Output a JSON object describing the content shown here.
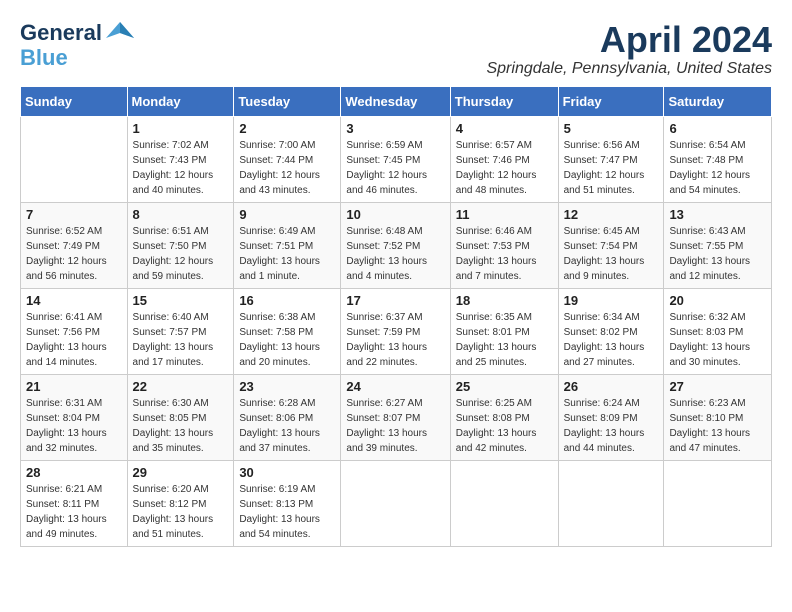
{
  "logo": {
    "line1": "General",
    "line2": "Blue",
    "bird_symbol": "▲"
  },
  "title": "April 2024",
  "location": "Springdale, Pennsylvania, United States",
  "days_of_week": [
    "Sunday",
    "Monday",
    "Tuesday",
    "Wednesday",
    "Thursday",
    "Friday",
    "Saturday"
  ],
  "weeks": [
    [
      {
        "day": "",
        "sunrise": "",
        "sunset": "",
        "daylight": ""
      },
      {
        "day": "1",
        "sunrise": "Sunrise: 7:02 AM",
        "sunset": "Sunset: 7:43 PM",
        "daylight": "Daylight: 12 hours and 40 minutes."
      },
      {
        "day": "2",
        "sunrise": "Sunrise: 7:00 AM",
        "sunset": "Sunset: 7:44 PM",
        "daylight": "Daylight: 12 hours and 43 minutes."
      },
      {
        "day": "3",
        "sunrise": "Sunrise: 6:59 AM",
        "sunset": "Sunset: 7:45 PM",
        "daylight": "Daylight: 12 hours and 46 minutes."
      },
      {
        "day": "4",
        "sunrise": "Sunrise: 6:57 AM",
        "sunset": "Sunset: 7:46 PM",
        "daylight": "Daylight: 12 hours and 48 minutes."
      },
      {
        "day": "5",
        "sunrise": "Sunrise: 6:56 AM",
        "sunset": "Sunset: 7:47 PM",
        "daylight": "Daylight: 12 hours and 51 minutes."
      },
      {
        "day": "6",
        "sunrise": "Sunrise: 6:54 AM",
        "sunset": "Sunset: 7:48 PM",
        "daylight": "Daylight: 12 hours and 54 minutes."
      }
    ],
    [
      {
        "day": "7",
        "sunrise": "Sunrise: 6:52 AM",
        "sunset": "Sunset: 7:49 PM",
        "daylight": "Daylight: 12 hours and 56 minutes."
      },
      {
        "day": "8",
        "sunrise": "Sunrise: 6:51 AM",
        "sunset": "Sunset: 7:50 PM",
        "daylight": "Daylight: 12 hours and 59 minutes."
      },
      {
        "day": "9",
        "sunrise": "Sunrise: 6:49 AM",
        "sunset": "Sunset: 7:51 PM",
        "daylight": "Daylight: 13 hours and 1 minute."
      },
      {
        "day": "10",
        "sunrise": "Sunrise: 6:48 AM",
        "sunset": "Sunset: 7:52 PM",
        "daylight": "Daylight: 13 hours and 4 minutes."
      },
      {
        "day": "11",
        "sunrise": "Sunrise: 6:46 AM",
        "sunset": "Sunset: 7:53 PM",
        "daylight": "Daylight: 13 hours and 7 minutes."
      },
      {
        "day": "12",
        "sunrise": "Sunrise: 6:45 AM",
        "sunset": "Sunset: 7:54 PM",
        "daylight": "Daylight: 13 hours and 9 minutes."
      },
      {
        "day": "13",
        "sunrise": "Sunrise: 6:43 AM",
        "sunset": "Sunset: 7:55 PM",
        "daylight": "Daylight: 13 hours and 12 minutes."
      }
    ],
    [
      {
        "day": "14",
        "sunrise": "Sunrise: 6:41 AM",
        "sunset": "Sunset: 7:56 PM",
        "daylight": "Daylight: 13 hours and 14 minutes."
      },
      {
        "day": "15",
        "sunrise": "Sunrise: 6:40 AM",
        "sunset": "Sunset: 7:57 PM",
        "daylight": "Daylight: 13 hours and 17 minutes."
      },
      {
        "day": "16",
        "sunrise": "Sunrise: 6:38 AM",
        "sunset": "Sunset: 7:58 PM",
        "daylight": "Daylight: 13 hours and 20 minutes."
      },
      {
        "day": "17",
        "sunrise": "Sunrise: 6:37 AM",
        "sunset": "Sunset: 7:59 PM",
        "daylight": "Daylight: 13 hours and 22 minutes."
      },
      {
        "day": "18",
        "sunrise": "Sunrise: 6:35 AM",
        "sunset": "Sunset: 8:01 PM",
        "daylight": "Daylight: 13 hours and 25 minutes."
      },
      {
        "day": "19",
        "sunrise": "Sunrise: 6:34 AM",
        "sunset": "Sunset: 8:02 PM",
        "daylight": "Daylight: 13 hours and 27 minutes."
      },
      {
        "day": "20",
        "sunrise": "Sunrise: 6:32 AM",
        "sunset": "Sunset: 8:03 PM",
        "daylight": "Daylight: 13 hours and 30 minutes."
      }
    ],
    [
      {
        "day": "21",
        "sunrise": "Sunrise: 6:31 AM",
        "sunset": "Sunset: 8:04 PM",
        "daylight": "Daylight: 13 hours and 32 minutes."
      },
      {
        "day": "22",
        "sunrise": "Sunrise: 6:30 AM",
        "sunset": "Sunset: 8:05 PM",
        "daylight": "Daylight: 13 hours and 35 minutes."
      },
      {
        "day": "23",
        "sunrise": "Sunrise: 6:28 AM",
        "sunset": "Sunset: 8:06 PM",
        "daylight": "Daylight: 13 hours and 37 minutes."
      },
      {
        "day": "24",
        "sunrise": "Sunrise: 6:27 AM",
        "sunset": "Sunset: 8:07 PM",
        "daylight": "Daylight: 13 hours and 39 minutes."
      },
      {
        "day": "25",
        "sunrise": "Sunrise: 6:25 AM",
        "sunset": "Sunset: 8:08 PM",
        "daylight": "Daylight: 13 hours and 42 minutes."
      },
      {
        "day": "26",
        "sunrise": "Sunrise: 6:24 AM",
        "sunset": "Sunset: 8:09 PM",
        "daylight": "Daylight: 13 hours and 44 minutes."
      },
      {
        "day": "27",
        "sunrise": "Sunrise: 6:23 AM",
        "sunset": "Sunset: 8:10 PM",
        "daylight": "Daylight: 13 hours and 47 minutes."
      }
    ],
    [
      {
        "day": "28",
        "sunrise": "Sunrise: 6:21 AM",
        "sunset": "Sunset: 8:11 PM",
        "daylight": "Daylight: 13 hours and 49 minutes."
      },
      {
        "day": "29",
        "sunrise": "Sunrise: 6:20 AM",
        "sunset": "Sunset: 8:12 PM",
        "daylight": "Daylight: 13 hours and 51 minutes."
      },
      {
        "day": "30",
        "sunrise": "Sunrise: 6:19 AM",
        "sunset": "Sunset: 8:13 PM",
        "daylight": "Daylight: 13 hours and 54 minutes."
      },
      {
        "day": "",
        "sunrise": "",
        "sunset": "",
        "daylight": ""
      },
      {
        "day": "",
        "sunrise": "",
        "sunset": "",
        "daylight": ""
      },
      {
        "day": "",
        "sunrise": "",
        "sunset": "",
        "daylight": ""
      },
      {
        "day": "",
        "sunrise": "",
        "sunset": "",
        "daylight": ""
      }
    ]
  ]
}
